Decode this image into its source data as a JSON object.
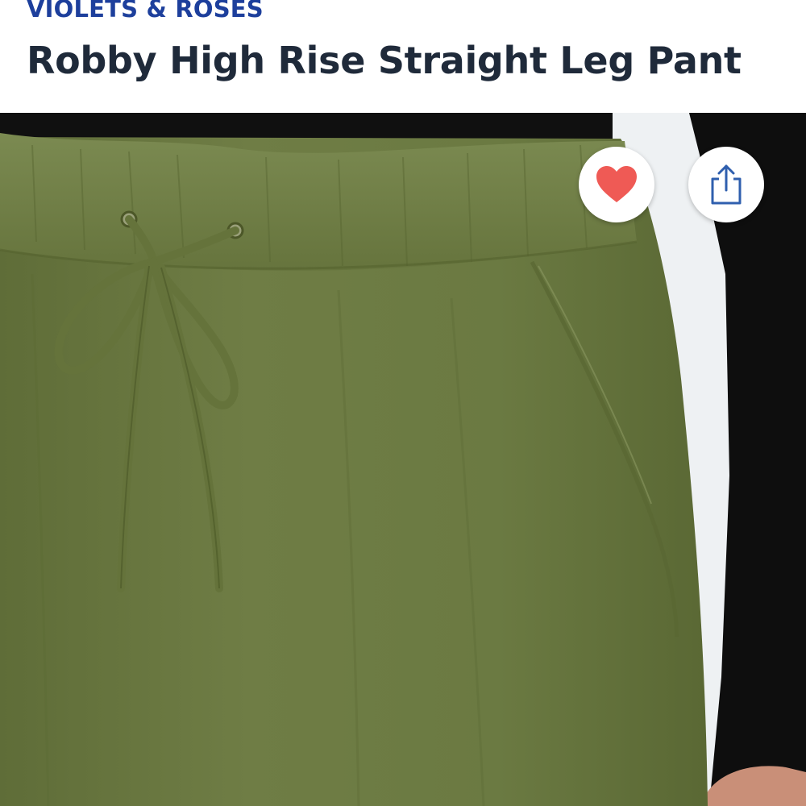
{
  "product": {
    "brand": "VIOLETS & ROSES",
    "title": "Robby High Rise Straight Leg Pant"
  },
  "actions": {
    "favorite_icon": "heart-icon",
    "share_icon": "share-icon"
  },
  "colors": {
    "brand_text": "#1d3f9c",
    "title_text": "#1f2a3a",
    "heart": "#ef5a55",
    "share_icon": "#2f5fae",
    "fabric": "#6f7d45",
    "sleeve": "#0e0e0e"
  }
}
